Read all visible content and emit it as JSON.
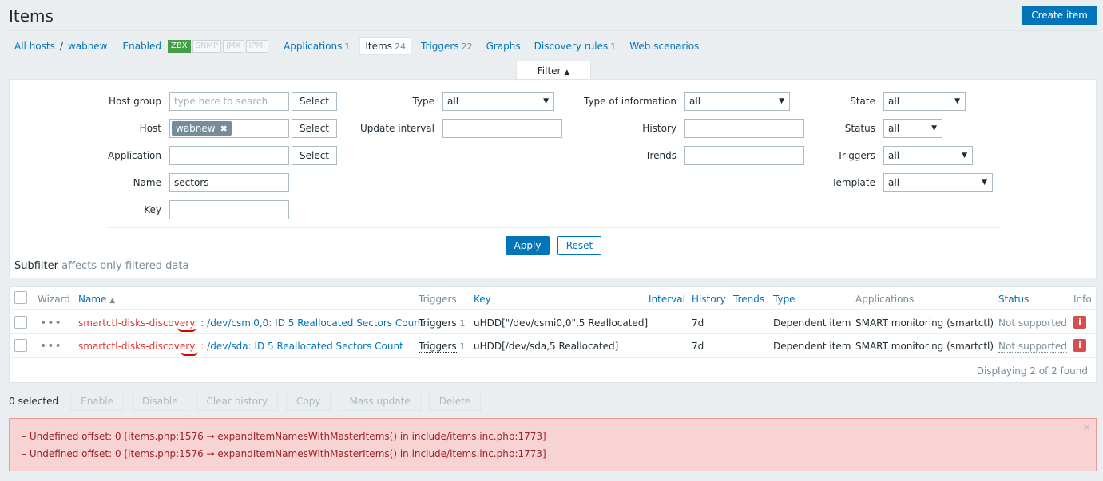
{
  "header": {
    "title": "Items",
    "create_label": "Create item"
  },
  "hostnav": {
    "all_hosts": "All hosts",
    "separator": "/",
    "host": "wabnew",
    "status": "Enabled",
    "badges": [
      "ZBX",
      "SNMP",
      "JMX",
      "IPMI"
    ],
    "tabs": [
      {
        "label": "Applications",
        "count": "1"
      },
      {
        "label": "Items",
        "count": "24"
      },
      {
        "label": "Triggers",
        "count": "22"
      },
      {
        "label": "Graphs",
        "count": ""
      },
      {
        "label": "Discovery rules",
        "count": "1"
      },
      {
        "label": "Web scenarios",
        "count": ""
      }
    ]
  },
  "filter": {
    "tab_label": "Filter",
    "host_group_label": "Host group",
    "host_group_placeholder": "type here to search",
    "host_label": "Host",
    "host_chip": "wabnew",
    "application_label": "Application",
    "name_label": "Name",
    "name_value": "sectors",
    "key_label": "Key",
    "select_label": "Select",
    "type_label": "Type",
    "type_value": "all",
    "update_interval_label": "Update interval",
    "type_info_label": "Type of information",
    "type_info_value": "all",
    "history_label": "History",
    "trends_label": "Trends",
    "state_label": "State",
    "state_value": "all",
    "status_label": "Status",
    "status_value": "all",
    "triggers_label": "Triggers",
    "triggers_value": "all",
    "template_label": "Template",
    "template_value": "all",
    "apply_label": "Apply",
    "reset_label": "Reset",
    "subfilter_label": "Subfilter",
    "subfilter_note": "affects only filtered data"
  },
  "table": {
    "columns": {
      "wizard": "Wizard",
      "name": "Name",
      "triggers": "Triggers",
      "key": "Key",
      "interval": "Interval",
      "history": "History",
      "trends": "Trends",
      "type": "Type",
      "applications": "Applications",
      "status": "Status",
      "info": "Info"
    },
    "rows": [
      {
        "dots": "•••",
        "prefix": "smartctl-disks-discovery",
        "sep": ": :",
        "name": "/dev/csmi0,0: ID 5 Reallocated Sectors Count",
        "triggers": "Triggers",
        "trig_count": "1",
        "key": "uHDD[\"/dev/csmi0,0\",5 Reallocated]",
        "interval": "",
        "history": "7d",
        "trends": "",
        "type": "Dependent item",
        "applications": "SMART monitoring (smartctl)",
        "status": "Not supported",
        "info": "i"
      },
      {
        "dots": "•••",
        "prefix": "smartctl-disks-discovery",
        "sep": ": :",
        "name": "/dev/sda: ID 5 Reallocated Sectors Count",
        "triggers": "Triggers",
        "trig_count": "1",
        "key": "uHDD[/dev/sda,5 Reallocated]",
        "interval": "",
        "history": "7d",
        "trends": "",
        "type": "Dependent item",
        "applications": "SMART monitoring (smartctl)",
        "status": "Not supported",
        "info": "i"
      }
    ],
    "footer": "Displaying 2 of 2 found"
  },
  "bulk": {
    "selected": "0 selected",
    "buttons": [
      "Enable",
      "Disable",
      "Clear history",
      "Copy",
      "Mass update",
      "Delete"
    ]
  },
  "errors": {
    "lines": [
      "–  Undefined offset: 0 [items.php:1576 → expandItemNamesWithMasterItems() in include/items.inc.php:1773]",
      "–  Undefined offset: 0 [items.php:1576 → expandItemNamesWithMasterItems() in include/items.inc.php:1773]"
    ],
    "close": "×"
  }
}
